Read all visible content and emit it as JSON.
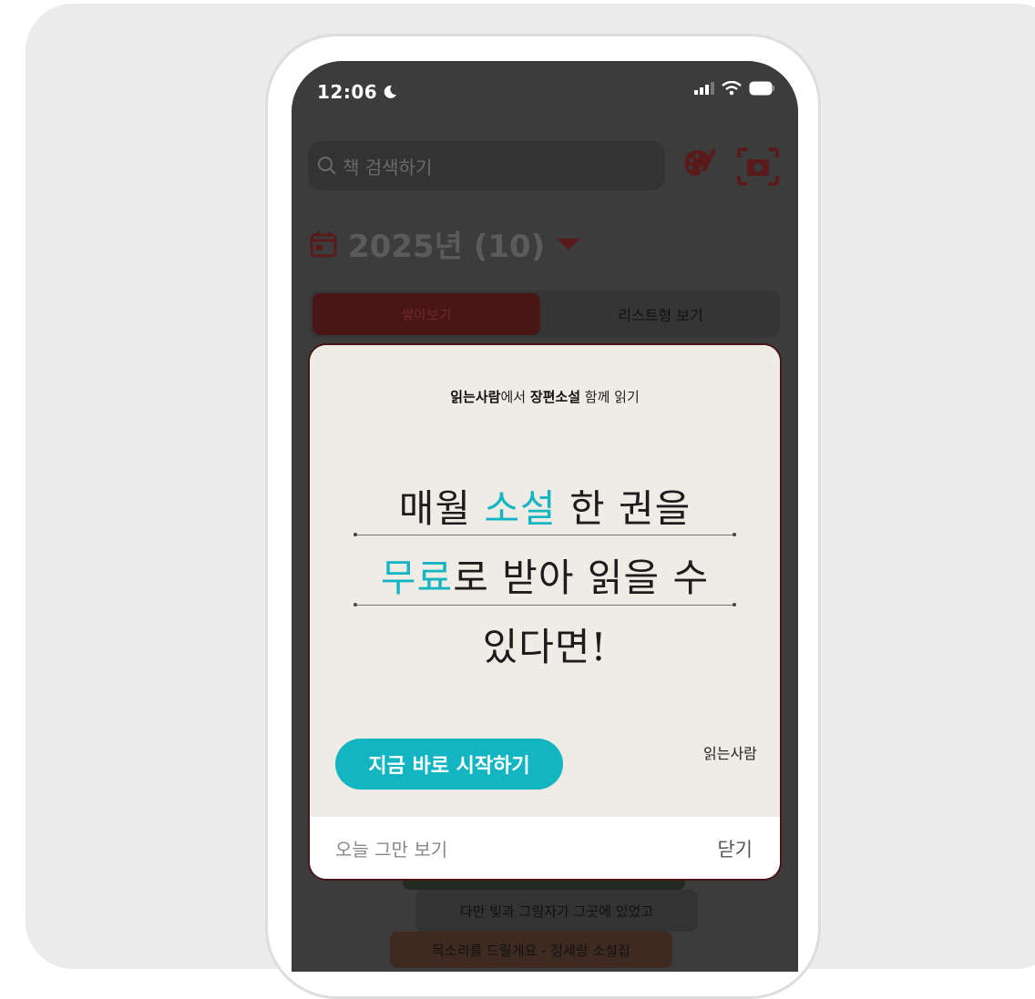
{
  "status_bar": {
    "time": "12:06"
  },
  "search": {
    "placeholder": "책 검색하기"
  },
  "year_selector": {
    "label": "2025년 (10)"
  },
  "view_toggle": {
    "stack_label": "쌓아보기",
    "list_label": "리스트형 보기"
  },
  "background_books": [
    "다만 빛과 그림자가 그곳에 있었고",
    "목소리를 드릴게요 - 정세랑 소설집"
  ],
  "modal": {
    "headline_brand": "읽는사람",
    "headline_mid": "에서 ",
    "headline_genre": "장편소설",
    "headline_end": " 함께 읽기",
    "line1_a": "매월 ",
    "line1_b": "소설",
    "line1_c": " 한 권을",
    "line2_a": "무료",
    "line2_b": "로 받아 읽을 수",
    "line3": "있다면!",
    "cta_label": "지금 바로 시작하기",
    "brand_logo": "읽는사람",
    "dismiss_today": "오늘 그만 보기",
    "close_label": "닫기"
  },
  "colors": {
    "accent": "#13b5c2",
    "brand_dark": "#4a1515",
    "screen_bg": "#3c3c3c"
  }
}
